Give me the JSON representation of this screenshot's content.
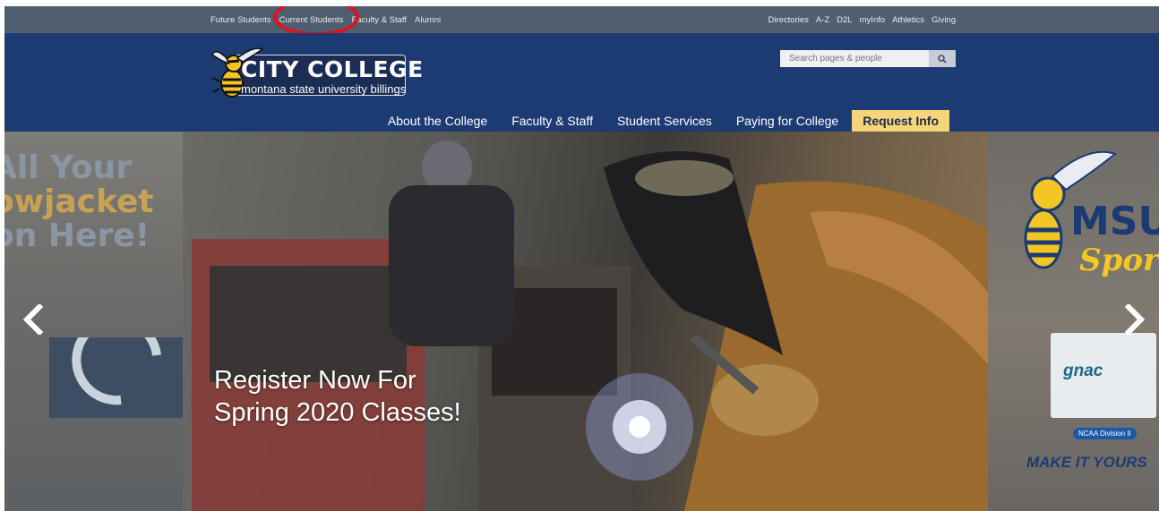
{
  "utility_nav": {
    "left": [
      "Future Students",
      "Current Students",
      "Faculty & Staff",
      "Alumni"
    ],
    "right": [
      "Directories",
      "A-Z",
      "D2L",
      "myInfo",
      "Athletics",
      "Giving"
    ]
  },
  "logo": {
    "title": "CITY COLLEGE",
    "subtitle": "montana state university billings"
  },
  "search": {
    "placeholder": "Search pages & people",
    "icon": "search-icon"
  },
  "main_nav": {
    "items": [
      "About the College",
      "Faculty & Staff",
      "Student Services",
      "Paying for College"
    ],
    "cta": "Request Info"
  },
  "carousel": {
    "prev_slide": {
      "line1": "All Your",
      "line2": "owjacket",
      "line3": "on Here!"
    },
    "current_slide": {
      "caption_line1": "Register Now For",
      "caption_line2": "Spring 2020 Classes!"
    },
    "next_slide": {
      "sports": "MSUB",
      "sports_script": "Sports",
      "gnac": "gnac",
      "ncaa": "NCAA Division II",
      "slogan": "MAKE IT YOURS"
    },
    "prev_icon": "chevron-left-icon",
    "next_icon": "chevron-right-icon"
  },
  "colors": {
    "utility_bar": "#4f5f6f",
    "header": "#1c3b73",
    "cta": "#f6d47a",
    "annotation": "#e3101a"
  }
}
